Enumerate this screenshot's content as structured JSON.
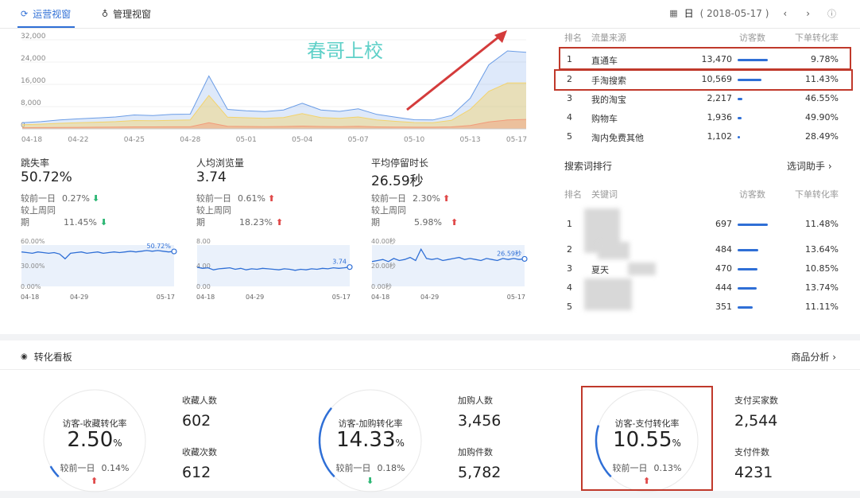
{
  "tabs": [
    {
      "label": "运营视窗",
      "icon": "refresh-icon"
    },
    {
      "label": "管理视窗",
      "icon": "medal-icon"
    }
  ],
  "date": {
    "period": "日",
    "value": "( 2018-05-17 )"
  },
  "watermark": "春哥上校",
  "main_chart": {
    "chart_data": {
      "type": "area",
      "y_ticks": [
        "32,000",
        "24,000",
        "16,000",
        "8,000",
        "0"
      ],
      "x_ticks": [
        "04-18",
        "04-22",
        "04-25",
        "04-28",
        "05-01",
        "05-04",
        "05-07",
        "05-10",
        "05-13",
        "05-17"
      ],
      "ylim": [
        0,
        32000
      ],
      "series": [
        {
          "color": "#6b9de6",
          "values": [
            2200,
            2600,
            3200,
            3600,
            3900,
            4300,
            5000,
            4800,
            5200,
            5300,
            19000,
            7000,
            6500,
            6200,
            6800,
            9200,
            6800,
            6300,
            7200,
            5200,
            4200,
            3300,
            3200,
            4800,
            11000,
            23000,
            28000,
            27500
          ]
        },
        {
          "color": "#f3d36b",
          "values": [
            1500,
            1700,
            2000,
            2200,
            2400,
            2600,
            3000,
            2900,
            3100,
            3200,
            12000,
            4200,
            4000,
            3800,
            4100,
            5500,
            4100,
            3800,
            4300,
            3200,
            2700,
            2300,
            2200,
            3100,
            7000,
            13500,
            16500,
            16500
          ]
        },
        {
          "color": "#f29b7a",
          "values": [
            400,
            450,
            500,
            550,
            600,
            650,
            700,
            700,
            750,
            750,
            2200,
            900,
            850,
            800,
            850,
            1000,
            850,
            800,
            900,
            700,
            650,
            600,
            600,
            700,
            1200,
            2500,
            3200,
            3400
          ]
        }
      ]
    }
  },
  "metrics": [
    {
      "title": "跳失率",
      "value": "50.72%",
      "cmp1_label": "较前一日",
      "cmp1_value": "0.27%",
      "cmp1_dir": "down",
      "cmp2_label": "较上周同",
      "cmp2_label2": "期",
      "cmp2_value": "11.45%",
      "cmp2_dir": "down",
      "chart_data": {
        "type": "area",
        "y_ticks": [
          "60.00%",
          "30.00%",
          "0.00%"
        ],
        "x_ticks": [
          "04-18",
          "04-29",
          "05-17"
        ],
        "last_label": "50.72%",
        "ylim": [
          0,
          60
        ],
        "values": [
          50,
          49,
          48,
          50,
          49,
          48,
          49,
          47,
          40,
          48,
          49,
          50,
          48,
          49,
          50,
          48,
          49,
          50,
          49,
          50,
          51,
          50,
          51,
          52,
          51,
          52,
          51,
          50,
          50.72
        ]
      }
    },
    {
      "title": "人均浏览量",
      "value": "3.74",
      "cmp1_label": "较前一日",
      "cmp1_value": "0.61%",
      "cmp1_dir": "up",
      "cmp2_label": "较上周同",
      "cmp2_label2": "期",
      "cmp2_value": "18.23%",
      "cmp2_dir": "up",
      "chart_data": {
        "type": "area",
        "y_ticks": [
          "8.00",
          "4.00",
          "0.00"
        ],
        "x_ticks": [
          "04-18",
          "04-29",
          "05-17"
        ],
        "last_label": "3.74",
        "ylim": [
          0,
          8
        ],
        "values": [
          3.7,
          3.5,
          3.6,
          3.2,
          3.4,
          3.5,
          3.6,
          3.3,
          3.5,
          3.2,
          3.4,
          3.3,
          3.5,
          3.4,
          3.3,
          3.2,
          3.4,
          3.3,
          3.1,
          3.3,
          3.2,
          3.4,
          3.3,
          3.5,
          3.4,
          3.6,
          3.5,
          3.6,
          3.74
        ]
      }
    },
    {
      "title": "平均停留时长",
      "value": "26.59秒",
      "cmp1_label": "较前一日",
      "cmp1_value": "2.30%",
      "cmp1_dir": "up",
      "cmp2_label": "较上周同",
      "cmp2_label2": "期",
      "cmp2_value": "5.98%",
      "cmp2_dir": "up",
      "chart_data": {
        "type": "area",
        "y_ticks": [
          "40.00秒",
          "20.00秒",
          "0.00秒"
        ],
        "x_ticks": [
          "04-18",
          "04-29",
          "05-17"
        ],
        "last_label": "26.59秒",
        "ylim": [
          0,
          40
        ],
        "values": [
          24,
          25,
          26,
          24,
          27,
          25,
          26,
          28,
          25,
          36,
          27,
          26,
          27,
          25,
          26,
          27,
          28,
          26,
          27,
          26,
          25,
          27,
          26,
          25,
          27,
          26,
          27,
          26,
          26.59
        ]
      }
    }
  ],
  "traffic": {
    "headers": {
      "rank": "排名",
      "source": "流量来源",
      "visitors": "访客数",
      "conv": "下单转化率"
    },
    "rows": [
      {
        "rank": "1",
        "name": "直通车",
        "visitors": "13,470",
        "conv": "9.78%",
        "bar": 1.0
      },
      {
        "rank": "2",
        "name": "手淘搜索",
        "visitors": "10,569",
        "conv": "11.43%",
        "bar": 0.78
      },
      {
        "rank": "3",
        "name": "我的淘宝",
        "visitors": "2,217",
        "conv": "46.55%",
        "bar": 0.16
      },
      {
        "rank": "4",
        "name": "购物车",
        "visitors": "1,936",
        "conv": "49.90%",
        "bar": 0.14
      },
      {
        "rank": "5",
        "name": "淘内免费其他",
        "visitors": "1,102",
        "conv": "28.49%",
        "bar": 0.08
      }
    ]
  },
  "search": {
    "title": "搜索词排行",
    "helper": "选词助手",
    "headers": {
      "rank": "排名",
      "keyword": "关键词",
      "visitors": "访客数",
      "conv": "下单转化率"
    },
    "rows": [
      {
        "rank": "1",
        "kw": "夏",
        "visitors": "697",
        "conv": "11.48%",
        "bar": 1.0
      },
      {
        "rank": "2",
        "kw": "",
        "visitors": "484",
        "conv": "13.64%",
        "bar": 0.69
      },
      {
        "rank": "3",
        "kw": "夏天",
        "visitors": "470",
        "conv": "10.85%",
        "bar": 0.67
      },
      {
        "rank": "4",
        "kw": "",
        "visitors": "444",
        "conv": "13.74%",
        "bar": 0.64
      },
      {
        "rank": "5",
        "kw": "",
        "visitors": "351",
        "conv": "11.11%",
        "bar": 0.5
      }
    ]
  },
  "conversion": {
    "title": "转化看板",
    "link": "商品分析",
    "gauges": [
      {
        "title": "访客-收藏转化率",
        "value": "2.50",
        "unit": "%",
        "cmp_label": "较前一日",
        "cmp_value": "0.14%",
        "dir": "up",
        "fraction": 0.025
      },
      {
        "title": "访客-加购转化率",
        "value": "14.33",
        "unit": "%",
        "cmp_label": "较前一日",
        "cmp_value": "0.18%",
        "dir": "down",
        "fraction": 0.1433
      },
      {
        "title": "访客-支付转化率",
        "value": "10.55",
        "unit": "%",
        "cmp_label": "较前一日",
        "cmp_value": "0.13%",
        "dir": "up",
        "fraction": 0.1055
      }
    ],
    "kpis": [
      {
        "l1": "收藏人数",
        "v1": "602",
        "l2": "收藏次数",
        "v2": "612"
      },
      {
        "l1": "加购人数",
        "v1": "3,456",
        "l2": "加购件数",
        "v2": "5,782"
      },
      {
        "l1": "支付买家数",
        "v1": "2,544",
        "l2": "支付件数",
        "v2": "4231"
      }
    ]
  },
  "colors": {
    "accent": "#2f6fd6",
    "up": "#e04a4a",
    "down": "#2bb673",
    "annot": "#c0392b"
  }
}
